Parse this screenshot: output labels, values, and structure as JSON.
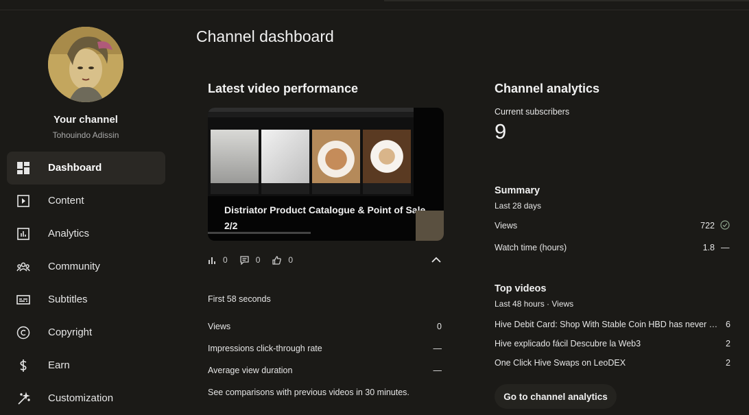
{
  "colors": {
    "background": "#1b1a17",
    "active_nav": "#2a2824",
    "text": "#f1f1f1",
    "muted": "#aaaaaa",
    "check": "#8fa88f"
  },
  "sidebar": {
    "your_channel": "Your channel",
    "channel_name": "Tohouindo Adissin",
    "items": [
      {
        "label": "Dashboard",
        "icon": "dashboard-icon",
        "active": true
      },
      {
        "label": "Content",
        "icon": "content-icon"
      },
      {
        "label": "Analytics",
        "icon": "analytics-icon"
      },
      {
        "label": "Community",
        "icon": "community-icon"
      },
      {
        "label": "Subtitles",
        "icon": "subtitles-icon"
      },
      {
        "label": "Copyright",
        "icon": "copyright-icon"
      },
      {
        "label": "Earn",
        "icon": "earn-icon"
      },
      {
        "label": "Customization",
        "icon": "customization-icon"
      }
    ]
  },
  "page_title": "Channel dashboard",
  "latest_video": {
    "title": "Latest video performance",
    "video_title": "Distriator Product Catalogue & Point of Sale 2/2",
    "stats": {
      "views": "0",
      "comments": "0",
      "likes": "0"
    },
    "period": "First 58 seconds",
    "metrics": [
      {
        "label": "Views",
        "value": "0"
      },
      {
        "label": "Impressions click-through rate",
        "value": "—"
      },
      {
        "label": "Average view duration",
        "value": "—"
      }
    ],
    "note": "See comparisons with previous videos in 30 minutes."
  },
  "analytics": {
    "title": "Channel analytics",
    "subscribers_label": "Current subscribers",
    "subscribers": "9",
    "summary": {
      "title": "Summary",
      "period": "Last 28 days",
      "rows": [
        {
          "label": "Views",
          "value": "722"
        },
        {
          "label": "Watch time (hours)",
          "value": "1.8"
        }
      ],
      "trend_neutral": "—"
    },
    "top_videos": {
      "title": "Top videos",
      "period": "Last 48 hours · Views",
      "items": [
        {
          "title": "Hive Debit Card: Shop With Stable Coin HBD has never …",
          "views": "6"
        },
        {
          "title": "Hive explicado fácil Descubre la Web3",
          "views": "2"
        },
        {
          "title": "One Click Hive Swaps on LeoDEX",
          "views": "2"
        }
      ]
    },
    "button_label": "Go to channel analytics"
  }
}
